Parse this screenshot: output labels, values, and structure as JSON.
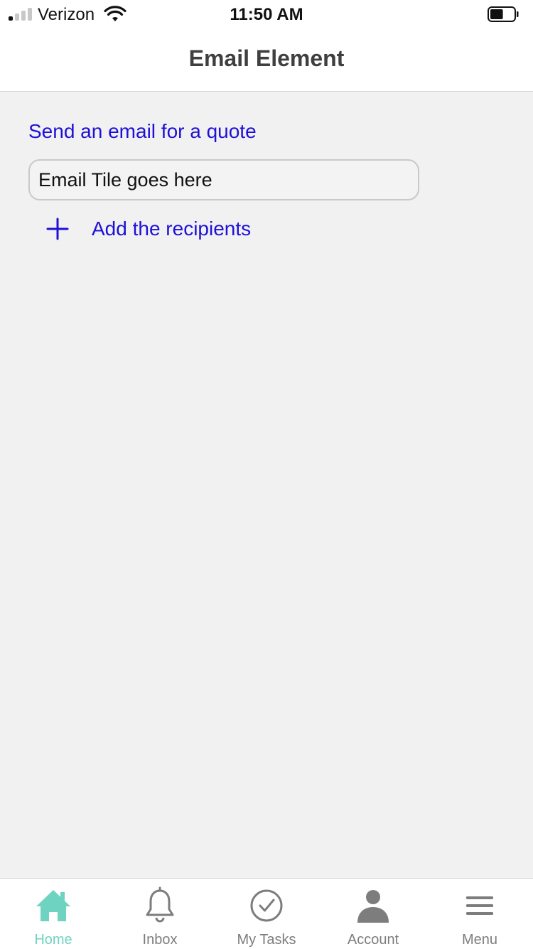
{
  "status_bar": {
    "carrier": "Verizon",
    "time": "11:50 AM",
    "signal_bars_active": 1,
    "signal_bars_total": 4,
    "battery_level": 0.55
  },
  "header": {
    "title": "Email Element"
  },
  "main": {
    "section_title": "Send an email for a quote",
    "email_title_value": "Email Tile goes here",
    "add_recipients_label": "Add the recipients"
  },
  "tab_bar": {
    "tabs": [
      {
        "label": "Home",
        "icon": "home-icon",
        "active": true
      },
      {
        "label": "Inbox",
        "icon": "bell-icon",
        "active": false
      },
      {
        "label": "My Tasks",
        "icon": "check-circle-icon",
        "active": false
      },
      {
        "label": "Account",
        "icon": "user-icon",
        "active": false
      },
      {
        "label": "Menu",
        "icon": "hamburger-menu-icon",
        "active": false
      }
    ]
  },
  "colors": {
    "accent_link": "#1e10d8",
    "active_tab": "#6fd3c1",
    "inactive_tab": "#7d7d7d",
    "background": "#f1f1f1"
  }
}
